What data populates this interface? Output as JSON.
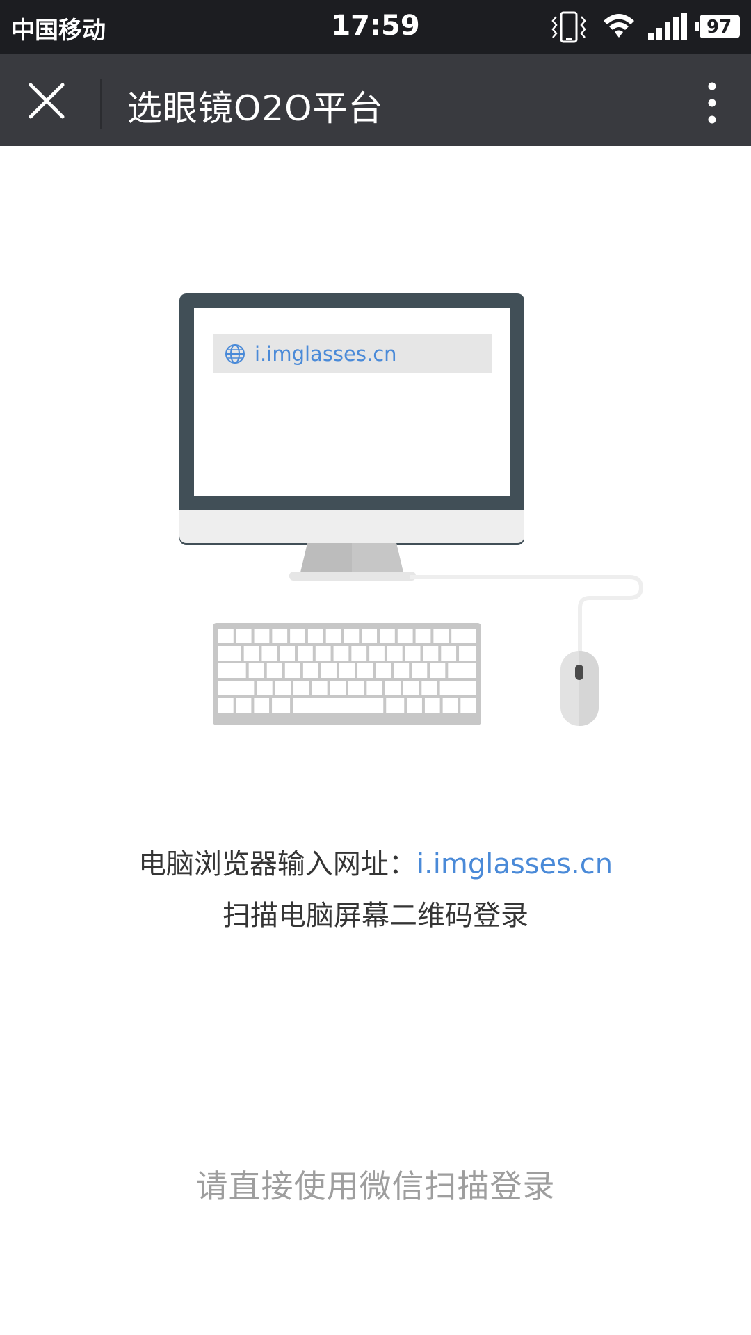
{
  "status_bar": {
    "carrier": "中国移动",
    "time": "17:59",
    "battery": "97",
    "icons": [
      "vibrate-icon",
      "wifi-icon",
      "signal-icon",
      "battery-icon"
    ]
  },
  "nav_bar": {
    "title": "选眼镜O2O平台",
    "close_icon": "close-icon",
    "more_icon": "more-vertical-icon"
  },
  "illustration": {
    "browser_url": "i.imglasses.cn",
    "icon": "globe-icon"
  },
  "instructions": {
    "prefix": "电脑浏览器输入网址：",
    "url": "i.imglasses.cn",
    "line2": "扫描电脑屏幕二维码登录"
  },
  "hint": "请直接使用微信扫描登录",
  "colors": {
    "status_bar_bg": "#1c1d21",
    "nav_bar_bg": "#393a3f",
    "link_blue": "#4a8ad8",
    "monitor_frame": "#414f57",
    "hint_gray": "#9e9e9e"
  }
}
